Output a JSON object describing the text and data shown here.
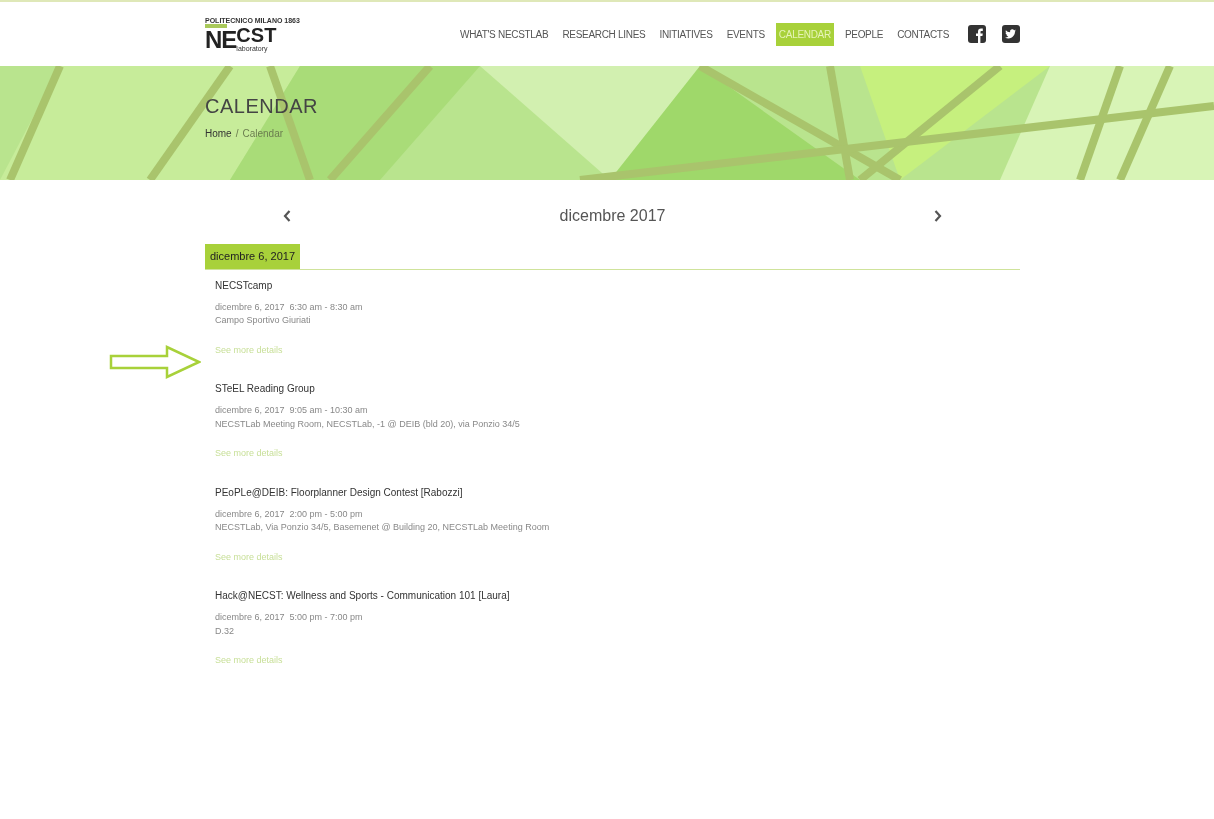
{
  "header": {
    "logo": {
      "top": "POLITECNICO MILANO 1863",
      "ne": "NE",
      "cst": "CST",
      "sub": "laboratory"
    },
    "nav": [
      {
        "label": "WHAT'S NECSTLAB",
        "selected": false
      },
      {
        "label": "RESEARCH LINES",
        "selected": false
      },
      {
        "label": "INITIATIVES",
        "selected": false
      },
      {
        "label": "EVENTS",
        "selected": false
      },
      {
        "label": "CALENDAR",
        "selected": true
      },
      {
        "label": "PEOPLE",
        "selected": false
      },
      {
        "label": "CONTACTS",
        "selected": false
      }
    ],
    "social": [
      {
        "kind": "facebook"
      },
      {
        "kind": "twitter"
      }
    ]
  },
  "banner": {
    "title": "CALENDAR",
    "breadcrumb": [
      {
        "label": "Home",
        "kind": "link"
      },
      {
        "label": "/",
        "kind": "separator"
      },
      {
        "label": "Calendar",
        "kind": "current"
      }
    ]
  },
  "month_nav": {
    "title": "dicembre 2017"
  },
  "day": {
    "date": "dicembre 6, 2017",
    "events": [
      {
        "title": "NECSTcamp",
        "when": "dicembre 6, 2017  6:30 am - 8:30 am",
        "where": "Campo Sportivo Giuriati",
        "link": "See more details",
        "pointer_arrow": true
      },
      {
        "title": "STeEL Reading Group",
        "when": "dicembre 6, 2017  9:05 am - 10:30 am",
        "where": "NECSTLab Meeting Room, NECSTLab, -1 @ DEIB (bld 20), via Ponzio 34/5",
        "link": "See more details",
        "pointer_arrow": false
      },
      {
        "title": "PEoPLe@DEIB: Floorplanner Design Contest [Rabozzi]",
        "when": "dicembre 6, 2017  2:00 pm - 5:00 pm",
        "where": "NECSTLab, Via Ponzio 34/5, Basemenet @ Building 20, NECSTLab Meeting Room",
        "link": "See more details",
        "pointer_arrow": false
      },
      {
        "title": "Hack@NECST: Wellness and Sports - Communication 101 [Laura]",
        "when": "dicembre 6, 2017  5:00 pm - 7:00 pm",
        "where": "D.32",
        "link": "See more details",
        "pointer_arrow": false
      }
    ]
  }
}
